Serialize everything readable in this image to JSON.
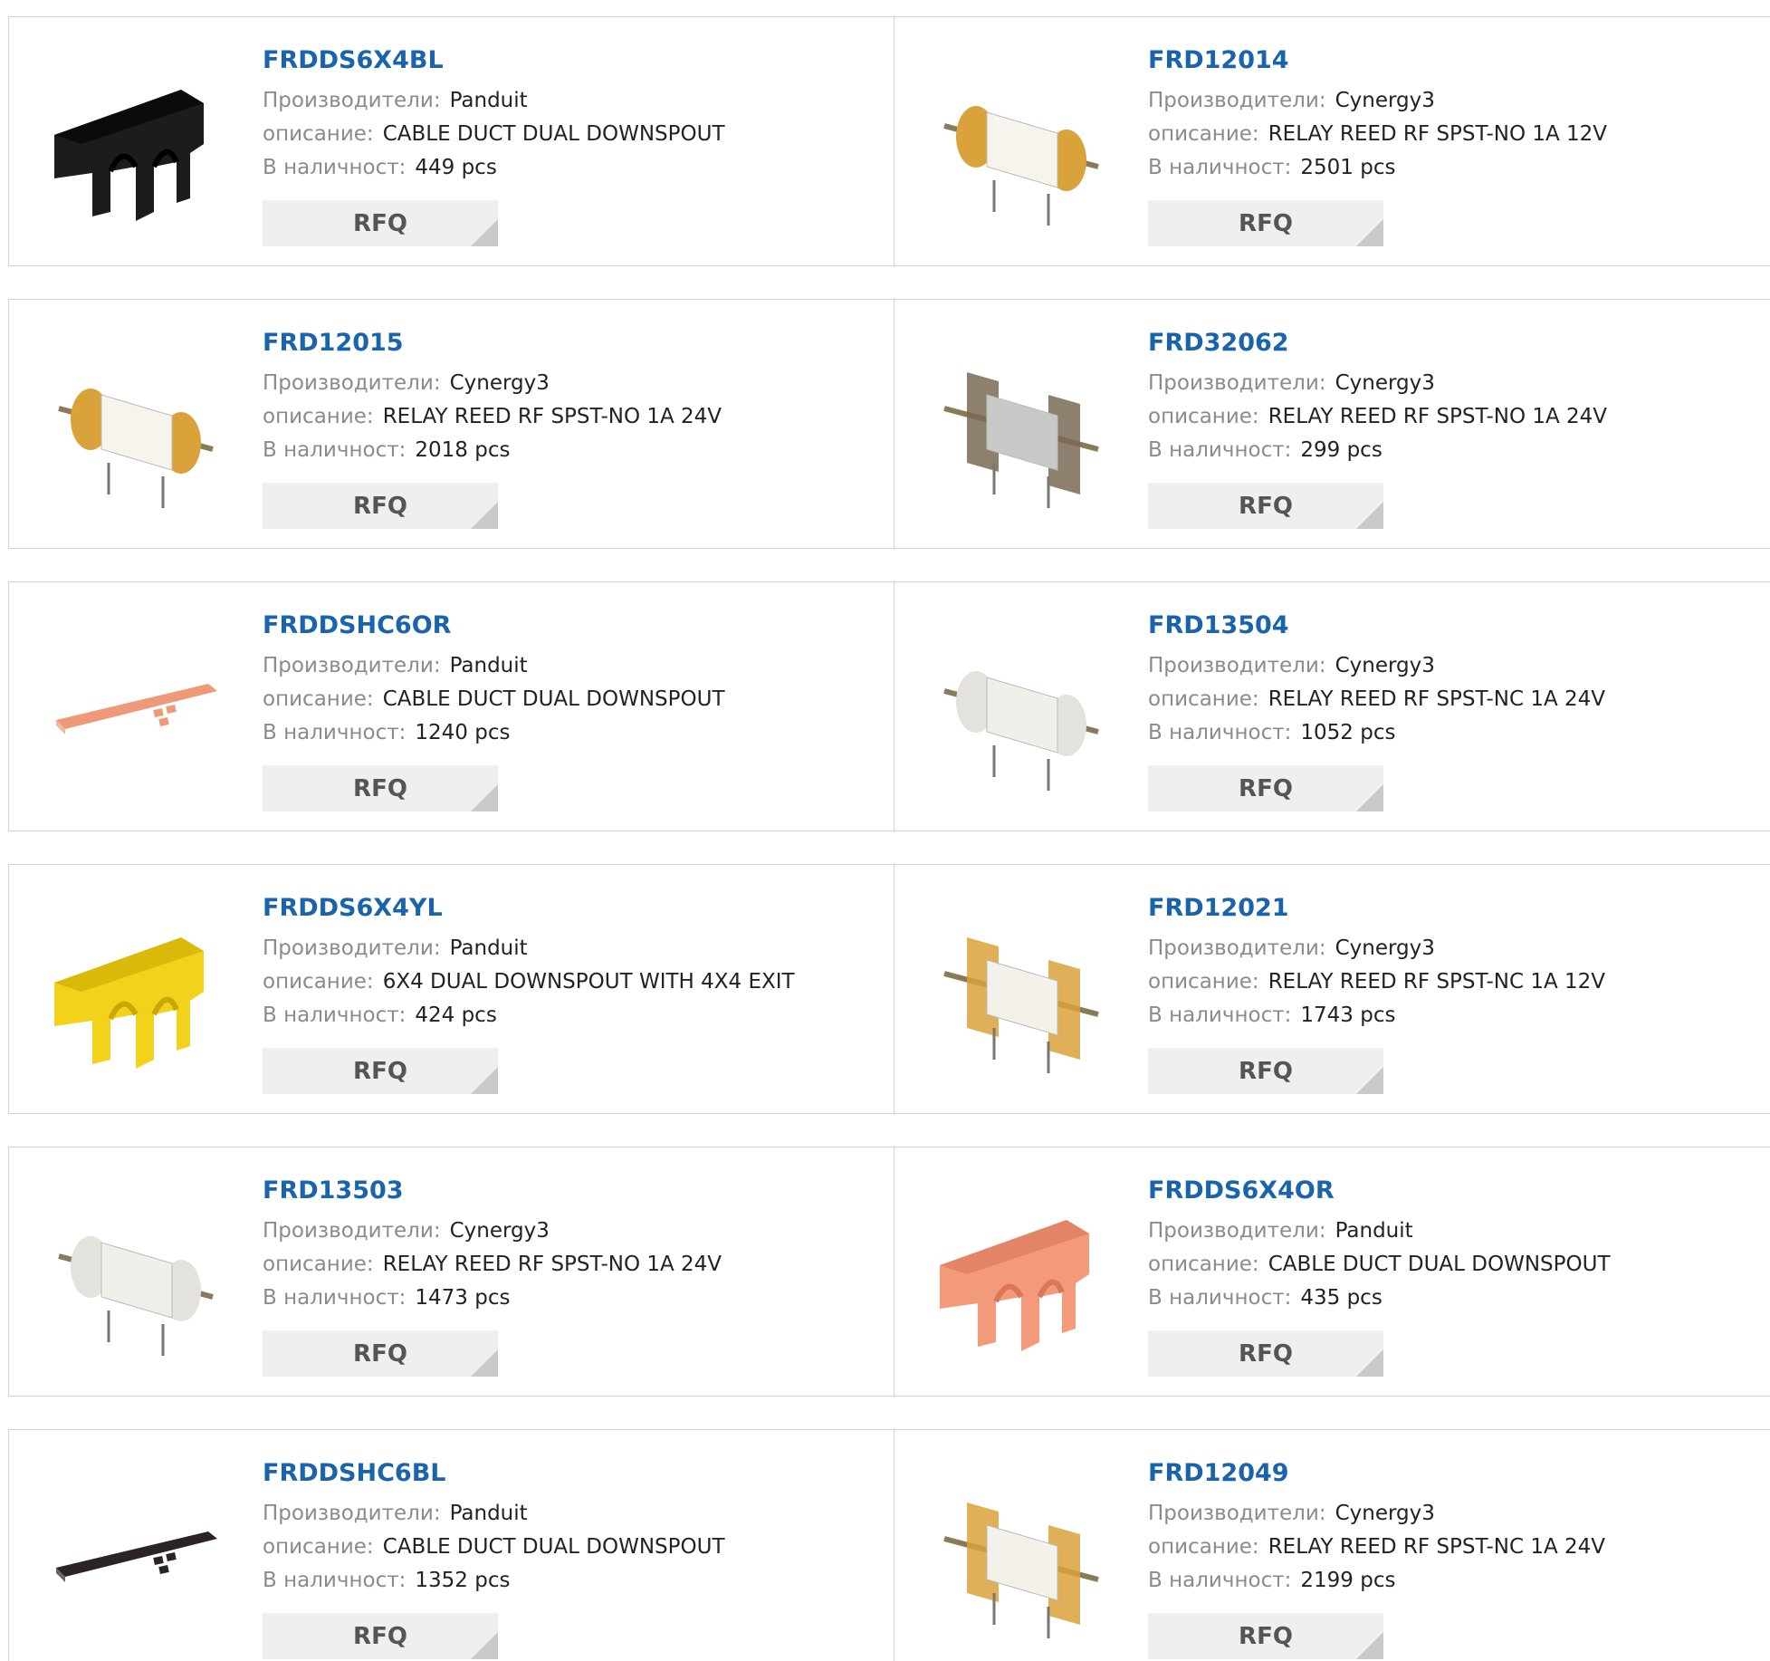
{
  "labels": {
    "manufacturer": "Производители:",
    "description": "описание:",
    "stock": "В наличност:",
    "rfq": "RFQ"
  },
  "products": [
    {
      "name": "FRDDS6X4BL",
      "manufacturer": "Panduit",
      "description": "CABLE DUCT DUAL DOWNSPOUT",
      "stock": "449 pcs",
      "image": "downspout-black"
    },
    {
      "name": "FRD12014",
      "manufacturer": "Cynergy3",
      "description": "RELAY REED RF SPST-NO 1A 12V",
      "stock": "2501 pcs",
      "image": "relay-amber"
    },
    {
      "name": "FRD12015",
      "manufacturer": "Cynergy3",
      "description": "RELAY REED RF SPST-NO 1A 24V",
      "stock": "2018 pcs",
      "image": "relay-amber"
    },
    {
      "name": "FRD32062",
      "manufacturer": "Cynergy3",
      "description": "RELAY REED RF SPST-NO 1A 24V",
      "stock": "299 pcs",
      "image": "relay-metal"
    },
    {
      "name": "FRDDSHC6OR",
      "manufacturer": "Panduit",
      "description": "CABLE DUCT DUAL DOWNSPOUT",
      "stock": "1240 pcs",
      "image": "cover-orange"
    },
    {
      "name": "FRD13504",
      "manufacturer": "Cynergy3",
      "description": "RELAY REED RF SPST-NC 1A 24V",
      "stock": "1052 pcs",
      "image": "relay-white"
    },
    {
      "name": "FRDDS6X4YL",
      "manufacturer": "Panduit",
      "description": "6X4 DUAL DOWNSPOUT WITH 4X4 EXIT",
      "stock": "424 pcs",
      "image": "downspout-yellow"
    },
    {
      "name": "FRD12021",
      "manufacturer": "Cynergy3",
      "description": "RELAY REED RF SPST-NC 1A 12V",
      "stock": "1743 pcs",
      "image": "relay-amber-frame"
    },
    {
      "name": "FRD13503",
      "manufacturer": "Cynergy3",
      "description": "RELAY REED RF SPST-NO 1A 24V",
      "stock": "1473 pcs",
      "image": "relay-white"
    },
    {
      "name": "FRDDS6X4OR",
      "manufacturer": "Panduit",
      "description": "CABLE DUCT DUAL DOWNSPOUT",
      "stock": "435 pcs",
      "image": "downspout-orange"
    },
    {
      "name": "FRDDSHC6BL",
      "manufacturer": "Panduit",
      "description": "CABLE DUCT DUAL DOWNSPOUT",
      "stock": "1352 pcs",
      "image": "cover-black"
    },
    {
      "name": "FRD12049",
      "manufacturer": "Cynergy3",
      "description": "RELAY REED RF SPST-NC 1A 24V",
      "stock": "2199 pcs",
      "image": "relay-amber-frame"
    }
  ],
  "colors": {
    "link": "#1a64ad",
    "label": "#8b8b8b",
    "value": "#222222",
    "border": "#d5d5d5",
    "button_bg": "#efefef"
  }
}
